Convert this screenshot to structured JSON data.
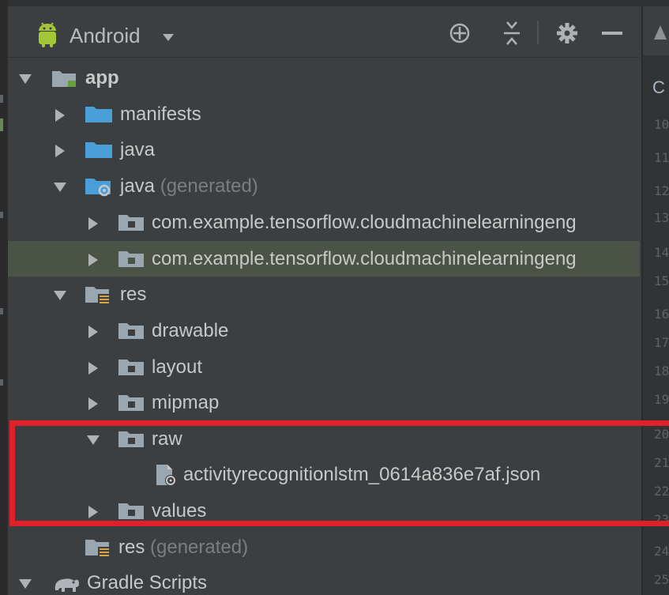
{
  "toolbar": {
    "view_mode": "Android"
  },
  "tree": {
    "items": [
      {
        "label": "app",
        "suffix": ""
      },
      {
        "label": "manifests",
        "suffix": ""
      },
      {
        "label": "java",
        "suffix": ""
      },
      {
        "label": "java",
        "suffix": "(generated)"
      },
      {
        "label": "com.example.tensorflow.cloudmachinelearningeng",
        "suffix": ""
      },
      {
        "label": "com.example.tensorflow.cloudmachinelearningeng",
        "suffix": ""
      },
      {
        "label": "res",
        "suffix": ""
      },
      {
        "label": "drawable",
        "suffix": ""
      },
      {
        "label": "layout",
        "suffix": ""
      },
      {
        "label": "mipmap",
        "suffix": ""
      },
      {
        "label": "raw",
        "suffix": ""
      },
      {
        "label": "activityrecognitionlstm_0614a836e7af.json",
        "suffix": ""
      },
      {
        "label": "values",
        "suffix": ""
      },
      {
        "label": "res",
        "suffix": "(generated)"
      },
      {
        "label": "Gradle Scripts",
        "suffix": ""
      }
    ]
  },
  "editor": {
    "tab_letter": "C",
    "line_numbers": [
      "10",
      "11",
      "12",
      "13",
      "14",
      "15",
      "16",
      "17",
      "18",
      "19",
      "20",
      "21",
      "22",
      "23",
      "24",
      "25"
    ]
  },
  "colors": {
    "background": "#3c3f41",
    "selection": "#4b5346",
    "highlight": "#e0212b",
    "folder_blue": "#4a9fd8",
    "android_green": "#a4c639"
  }
}
